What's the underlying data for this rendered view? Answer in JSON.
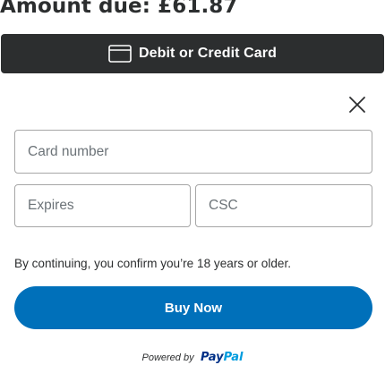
{
  "header": {
    "amount_due": "Amount due: £61.87"
  },
  "payment_method": {
    "label": "Debit or Credit Card",
    "icon": "credit-card-icon"
  },
  "form": {
    "close_icon": "close-icon",
    "card_number_placeholder": "Card number",
    "expires_placeholder": "Expires",
    "csc_placeholder": "CSC"
  },
  "disclaimer": "By continuing, you confirm you’re 18 years or older.",
  "buy_now_label": "Buy Now",
  "footer": {
    "powered_by": "Powered by",
    "logo_pay": "Pay",
    "logo_pal": "Pal"
  },
  "colors": {
    "dark_button": "#2c2e2f",
    "primary": "#0070ba",
    "paypal_dark_blue": "#003087",
    "paypal_light_blue": "#009cde"
  }
}
